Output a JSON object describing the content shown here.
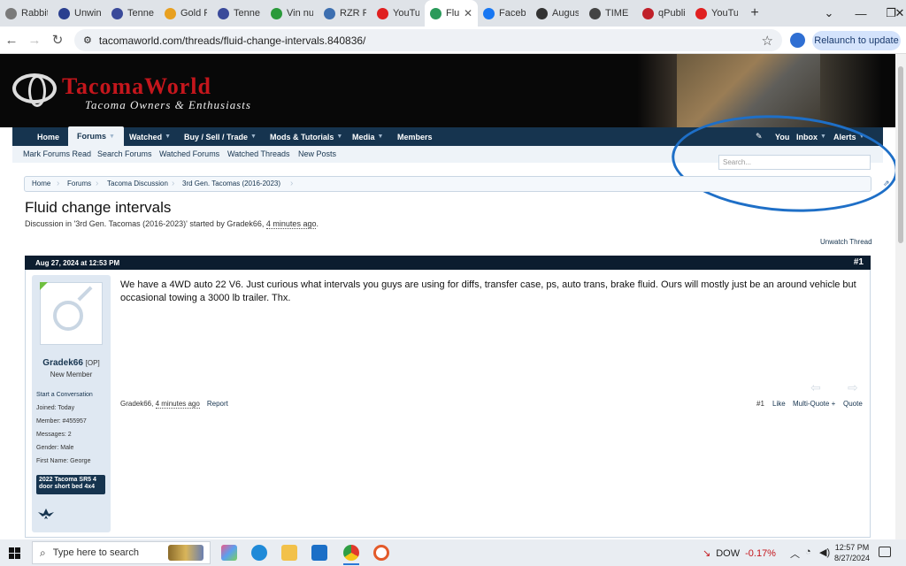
{
  "browser": {
    "tabs": [
      {
        "label": "Rabbit",
        "color": "#7a7a7a"
      },
      {
        "label": "Unwinc",
        "color": "#2a3f8f"
      },
      {
        "label": "Tennes",
        "color": "#3a4a9a"
      },
      {
        "label": "Gold P",
        "color": "#e8a020"
      },
      {
        "label": "Tennes",
        "color": "#3a4a9a"
      },
      {
        "label": "Vin nu",
        "color": "#2a9a3a"
      },
      {
        "label": "RZR P",
        "color": "#3d6fb0"
      },
      {
        "label": "YouTu",
        "color": "#e02020"
      },
      {
        "label": "Flu",
        "color": "#2a9a5a"
      },
      {
        "label": "Facebo",
        "color": "#1877f2"
      },
      {
        "label": "August",
        "color": "#333333"
      },
      {
        "label": "TIME M",
        "color": "#444444"
      },
      {
        "label": "qPubli",
        "color": "#c0202a"
      },
      {
        "label": "YouTu",
        "color": "#e02020"
      }
    ],
    "active_tab_index": 8,
    "new_tab": "+",
    "url": "tacomaworld.com/threads/fluid-change-intervals.840836/",
    "relaunch": "Relaunch to update"
  },
  "site": {
    "logo_title": "TacomaWorld",
    "logo_subtitle": "Tacoma Owners & Enthusiasts",
    "nav": [
      "Home",
      "Forums",
      "Watched",
      "Buy / Sell / Trade",
      "Mods & Tutorials",
      "Media",
      "Members"
    ],
    "nav_right": [
      "You",
      "Inbox",
      "Alerts"
    ],
    "subnav": [
      "Mark Forums Read",
      "Search Forums",
      "Watched Forums",
      "Watched Threads",
      "New Posts"
    ],
    "search_placeholder": "Search..."
  },
  "breadcrumbs": [
    "Home",
    "Forums",
    "Tacoma Discussion",
    "3rd Gen. Tacomas (2016-2023)"
  ],
  "thread": {
    "title": "Fluid change intervals",
    "desc_prefix": "Discussion in '3rd Gen. Tacomas (2016-2023)' started by Gradek66, ",
    "desc_time": "4 minutes ago",
    "desc_suffix": ".",
    "unwatch": "Unwatch Thread"
  },
  "post": {
    "date": "Aug 27, 2024 at 12:53 PM",
    "number": "#1",
    "username": "Gradek66",
    "op_tag": "[OP]",
    "rank": "New Member",
    "info": [
      "Start a Conversation",
      "Joined: Today",
      "Member: #455957",
      "Messages: 2",
      "Gender: Male",
      "First Name: George"
    ],
    "badge": "2022 Tacoma SR5 4 door short bed 4x4",
    "message": "We have a 4WD auto 22 V6. Just curious what intervals you guys are using for diffs, transfer case, ps, auto trans, brake fluid. Ours will mostly just be an around vehicle but occasional towing a 3000 lb trailer. Thx.",
    "footer_author": "Gradek66, ",
    "footer_time": "4 minutes ago",
    "report": "Report",
    "actions": [
      "#1",
      "Like",
      "Multi-Quote +",
      "Quote"
    ]
  },
  "taskbar": {
    "search_text": "Type here to search",
    "ticker_name": "DOW",
    "ticker_change": "-0.17%",
    "time": "12:57 PM",
    "date": "8/27/2024"
  }
}
